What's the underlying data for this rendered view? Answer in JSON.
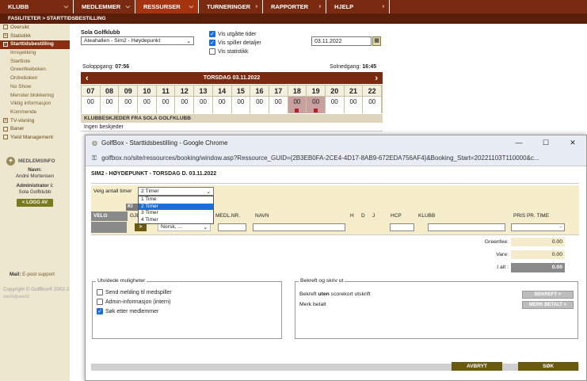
{
  "nav": [
    "KLUBB",
    "MEDLEMMER",
    "RESSURSER",
    "TURNERINGER",
    "RAPPORTER",
    "HJELP"
  ],
  "breadcrumb": "FASILITETER > STARTTIDSBESTILLING",
  "sidebar": {
    "items": [
      {
        "label": "Oversikt",
        "type": "head",
        "box": ""
      },
      {
        "label": "Statistikk",
        "type": "head",
        "box": "+"
      },
      {
        "label": "Starttidsbestilling",
        "type": "active",
        "box": "−"
      },
      {
        "label": "Innsjekking",
        "type": "sub"
      },
      {
        "label": "Startliste",
        "type": "sub"
      },
      {
        "label": "Greenfeeboken",
        "type": "sub"
      },
      {
        "label": "Ordreboken",
        "type": "sub"
      },
      {
        "label": "No Show",
        "type": "sub"
      },
      {
        "label": "Menster blokkering",
        "type": "sub"
      },
      {
        "label": "Viktig informasjon",
        "type": "sub"
      },
      {
        "label": "Kommende",
        "type": "sub"
      },
      {
        "label": "TV-visning",
        "type": "head",
        "box": "+"
      },
      {
        "label": "Baner",
        "type": "head",
        "box": ""
      },
      {
        "label": "Yield Management",
        "type": "head",
        "box": ""
      }
    ],
    "member_title": "MEDLEMSINFO",
    "name_label": "Navn:",
    "name": "André Mortensen",
    "admin_label": "Administrator i:",
    "admin": "Sola Golfklubb",
    "logout": "< LOGG AV",
    "mail_label": "Mail:",
    "mail_value": "E-post support",
    "copyright": "Copyright © GolfBox® 2002-2",
    "version": "site03@web02"
  },
  "main": {
    "club": "Sola Golfklubb",
    "resource": "Ateahallen - Sim2 - Høydepunkt",
    "checks": [
      {
        "label": "Vis utgåtte tider",
        "checked": true
      },
      {
        "label": "Vis spiller detaljer",
        "checked": true
      },
      {
        "label": "Vis statistikk",
        "checked": false
      }
    ],
    "date": "03.11.2022",
    "sunrise_label": "Soloppgang:",
    "sunrise": "07:56",
    "sunset_label": "Solnedgang:",
    "sunset": "16:45",
    "day": "TORSDAG 03.11.2022",
    "hours": [
      "07",
      "08",
      "09",
      "10",
      "11",
      "12",
      "13",
      "14",
      "15",
      "16",
      "17",
      "18",
      "19",
      "20",
      "21",
      "22"
    ],
    "values": [
      "00",
      "00",
      "00",
      "00",
      "00",
      "00",
      "00",
      "00",
      "00",
      "00",
      "00",
      "00",
      "00",
      "00",
      "00",
      "00"
    ],
    "messages_header": "KLUBBESKJEDER FRA SOLA GOLFKLUBB",
    "messages_body": "Ingen beskjeder"
  },
  "popup": {
    "window_title": "GolfBox - Starttidsbestilling - Google Chrome",
    "url": "golfbox.no/site/ressources/booking/window.asp?Ressource_GUID={2B3EB0FA-2CE4-4D17-8AB9-672EDA756AF4}&Booking_Start=20221103T110000&c...",
    "heading": "SIM2 - HØYDEPUNKT - TORSDAG D. 03.11.2022",
    "hours_label": "Velg antall timer",
    "hours_selected": "2 Timer",
    "hours_options": [
      "1 Time",
      "2 Timer",
      "3 Timer",
      "4 Timer"
    ],
    "col_kl": "Kl",
    "columns": [
      "VELG",
      "GJE",
      "MEDL.NR.",
      "NAVN",
      "H",
      "D",
      "J",
      "HCP",
      "KLUBB",
      "PRIS PR. TIME"
    ],
    "row_button": ">",
    "row_country": "Norsk, ...",
    "row_price": "-",
    "greenfee_label": "Greenfee:",
    "greenfee": "0.00",
    "vare_label": "Vare:",
    "vare": "0.00",
    "total_label": "I alt :",
    "total": "0.00",
    "ext_title": "Utvidede muligheter",
    "ext_options": [
      {
        "label": "Send melding til medspiller",
        "checked": false
      },
      {
        "label": "Admin-informasjon (intern)",
        "checked": false
      },
      {
        "label": "Søk etter medlemmer",
        "checked": true
      }
    ],
    "confirm_title": "Bekreft og skriv ut",
    "confirm_text_pre": "Bekreft ",
    "confirm_text_bold": "uten",
    "confirm_text_post": " scorekort utskrift",
    "mark_paid": "Merk betalt",
    "confirm_btn": "BEKREFT >",
    "markpaid_btn": "MERK BETALT >",
    "cancel_btn": "AVBRYT",
    "search_btn": "SØK"
  }
}
